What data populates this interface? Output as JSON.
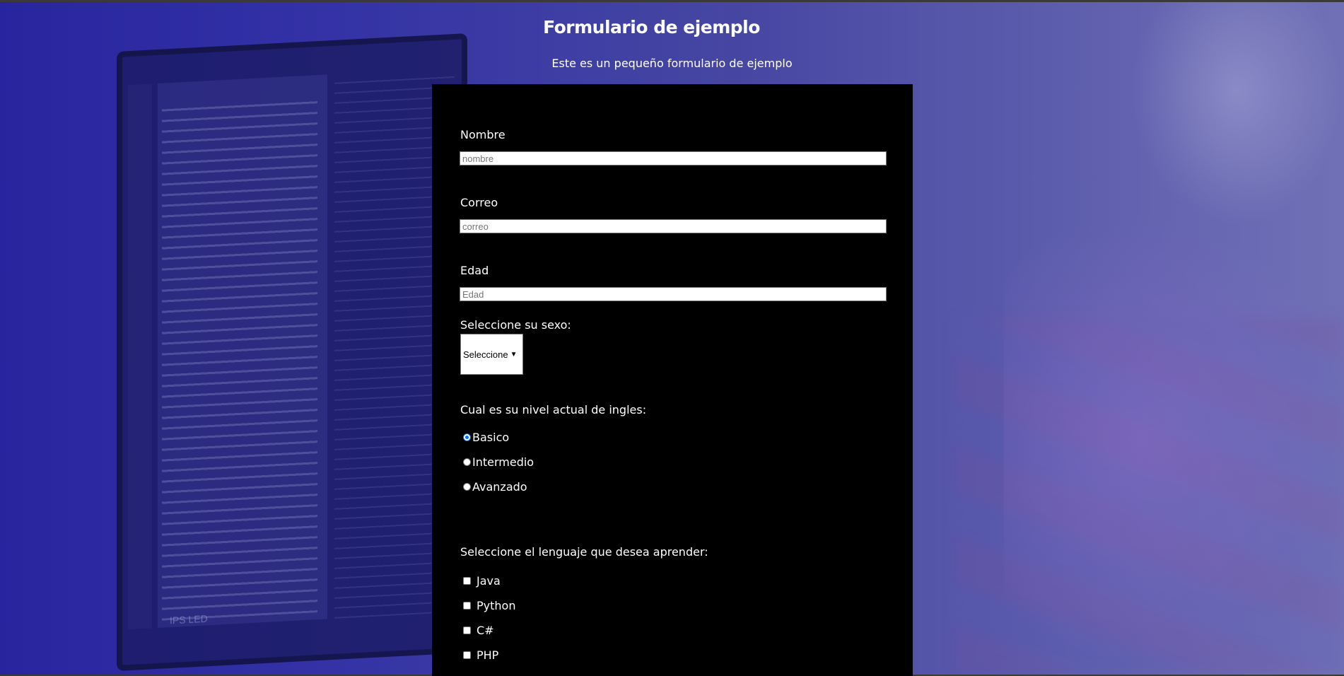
{
  "header": {
    "title": "Formulario de ejemplo",
    "subtitle": "Este es un pequeño formulario de ejemplo"
  },
  "background": {
    "laptop_brand": "IPS LED"
  },
  "form": {
    "name": {
      "label": "Nombre",
      "placeholder": "nombre",
      "value": ""
    },
    "email": {
      "label": "Correo",
      "placeholder": "correo",
      "value": ""
    },
    "age": {
      "label": "Edad",
      "placeholder": "Edad",
      "value": ""
    },
    "sex": {
      "label": "Seleccione su sexo:",
      "selected": "Seleccione"
    },
    "english_level": {
      "label": "Cual es su nivel actual de ingles:",
      "options": [
        {
          "label": "Basico",
          "checked": true
        },
        {
          "label": "Intermedio",
          "checked": false
        },
        {
          "label": "Avanzado",
          "checked": false
        }
      ]
    },
    "languages": {
      "label": "Seleccione el lenguaje que desea aprender:",
      "options": [
        {
          "label": "Java",
          "checked": false
        },
        {
          "label": "Python",
          "checked": false
        },
        {
          "label": "C#",
          "checked": false
        },
        {
          "label": "PHP",
          "checked": false
        }
      ]
    }
  },
  "colors": {
    "panel": "#000000",
    "text": "#ffffff",
    "radio_accent": "#0075ff"
  }
}
